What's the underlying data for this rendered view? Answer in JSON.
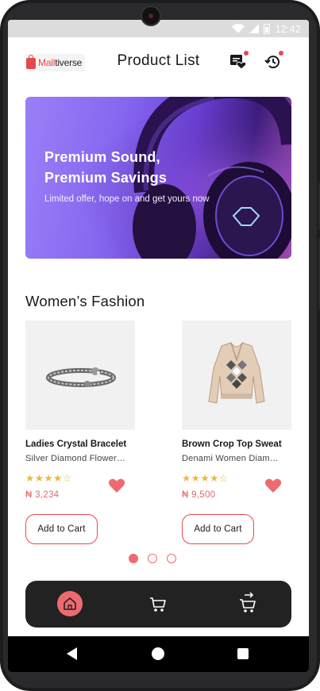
{
  "status_bar": {
    "time": "12:42"
  },
  "header": {
    "logo_prefix": "Mall",
    "logo_suffix": "tiverse",
    "title": "Product List"
  },
  "banner": {
    "title_line1": "Premium Sound,",
    "title_line2": "Premium Savings",
    "subtitle": "Limited offer, hope on and get yours now"
  },
  "section": {
    "title": "Women’s Fashion"
  },
  "products": [
    {
      "name": "Ladies Crystal Bracelet",
      "description": "Silver Diamond Flower…",
      "rating": 4,
      "rating_max": 5,
      "price": "₦ 3,234",
      "favorite": true,
      "button": "Add to Cart",
      "image_icon": "bracelet-image"
    },
    {
      "name": "Brown Crop Top Sweat",
      "description": "Denami Women Diam…",
      "rating": 4,
      "rating_max": 5,
      "price": "₦ 9,500",
      "favorite": true,
      "button": "Add to Cart",
      "image_icon": "sweater-image"
    }
  ],
  "carousel": {
    "pages": 3,
    "active": 0
  },
  "bottom_nav": {
    "items": [
      "home-icon",
      "cart-icon",
      "checkout-icon"
    ],
    "active": 0
  },
  "colors": {
    "accent": "#e5484d",
    "accent_soft": "#ef6a70",
    "star": "#f0b73c",
    "nav_bg": "#222222",
    "banner_start": "#9b7ff7",
    "banner_end": "#3a1b7a"
  }
}
